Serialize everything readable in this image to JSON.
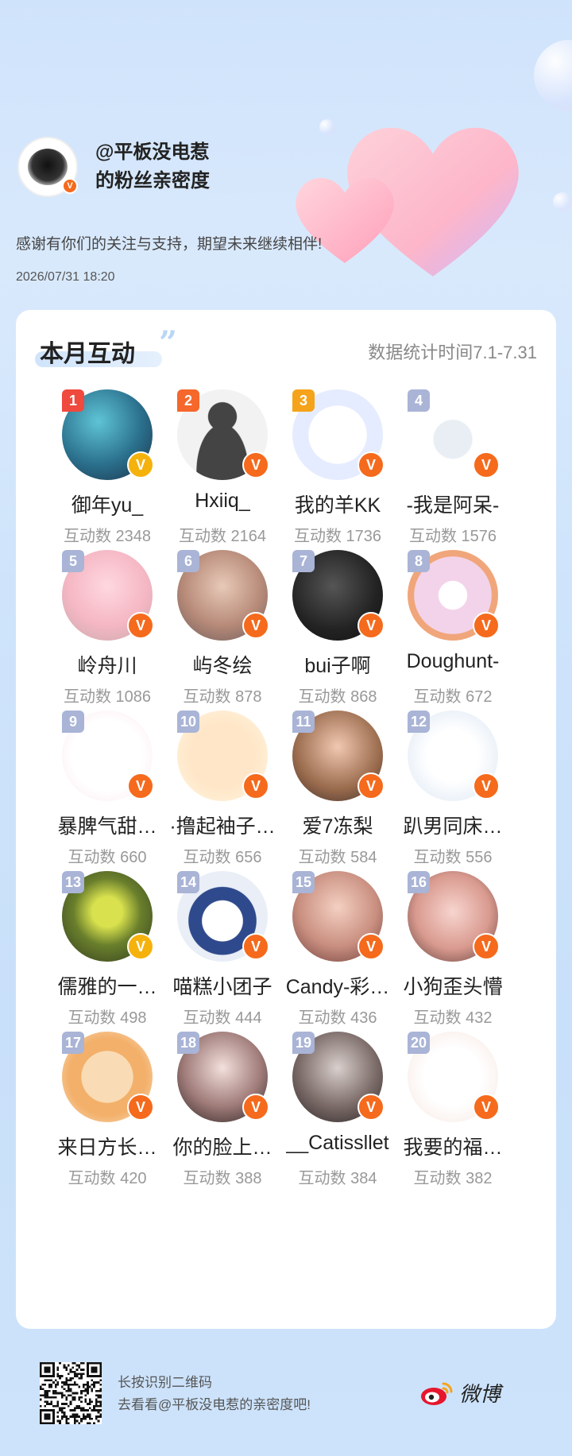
{
  "header": {
    "title_line1": "@平板没电惹",
    "title_line2": "的粉丝亲密度",
    "thanks": "感谢有你们的关注与支持，期望未来继续相伴!",
    "datetime": "2026/07/31  18:20"
  },
  "card": {
    "title": "本月互动",
    "stats_range": "数据统计时间7.1-7.31",
    "count_prefix": "互动数"
  },
  "fans": [
    {
      "rank": "1",
      "name": "御年yu_",
      "count": "互动数 2348"
    },
    {
      "rank": "2",
      "name": "Hxiiq_",
      "count": "互动数 2164"
    },
    {
      "rank": "3",
      "name": "我的羊KK",
      "count": "互动数 1736"
    },
    {
      "rank": "4",
      "name": "-我是阿呆-",
      "count": "互动数 1576"
    },
    {
      "rank": "5",
      "name": "岭舟川",
      "count": "互动数 1086"
    },
    {
      "rank": "6",
      "name": "屿冬绘",
      "count": "互动数 878"
    },
    {
      "rank": "7",
      "name": "bui子啊",
      "count": "互动数 868"
    },
    {
      "rank": "8",
      "name": "Doughunt-",
      "count": "互动数 672"
    },
    {
      "rank": "9",
      "name": "暴脾气甜…",
      "count": "互动数 660"
    },
    {
      "rank": "10",
      "name": "·撸起袖子…",
      "count": "互动数 656"
    },
    {
      "rank": "11",
      "name": "爱7冻梨",
      "count": "互动数 584"
    },
    {
      "rank": "12",
      "name": "趴男同床…",
      "count": "互动数 556"
    },
    {
      "rank": "13",
      "name": "儒雅的一…",
      "count": "互动数 498"
    },
    {
      "rank": "14",
      "name": "喵糕小团子",
      "count": "互动数 444"
    },
    {
      "rank": "15",
      "name": "Candy-彩…",
      "count": "互动数 436"
    },
    {
      "rank": "16",
      "name": "小狗歪头懵",
      "count": "互动数 432"
    },
    {
      "rank": "17",
      "name": "来日方长…",
      "count": "互动数 420"
    },
    {
      "rank": "18",
      "name": "你的脸上…",
      "count": "互动数 388"
    },
    {
      "rank": "19",
      "name": "__Catissllet",
      "count": "互动数 384"
    },
    {
      "rank": "20",
      "name": "我要的福…",
      "count": "互动数 382"
    }
  ],
  "footer": {
    "line1": "长按识别二维码",
    "line2": "去看看@平板没电惹的亲密度吧!",
    "brand": "微博"
  },
  "colors": {
    "rank1": "#f0493d",
    "rank2": "#f5672b",
    "rank3": "#f5a31a",
    "rank_other": "#a9b4d6",
    "verified": "#f56a1c",
    "verified_gold": "#f5b20d",
    "accent_soft": "#cfe4fb"
  },
  "icons": {
    "verified": "v-badge-icon",
    "qr": "qr-code-icon",
    "brand": "weibo-logo-icon"
  }
}
